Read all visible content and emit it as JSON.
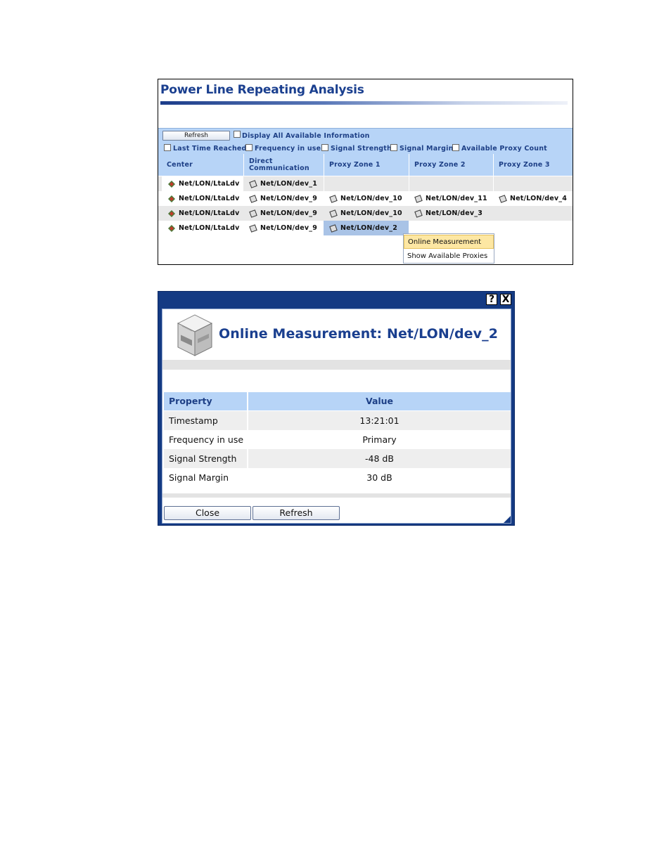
{
  "analysis": {
    "title": "Power Line Repeating Analysis",
    "refresh_label": "Refresh",
    "display_all_label": "Display All Available Information",
    "filters": [
      "Last Time Reached",
      "Frequency in use",
      "Signal Strength",
      "Signal Margin",
      "Available Proxy Count"
    ],
    "columns": [
      "Center",
      "Direct Communication",
      "Proxy Zone 1",
      "Proxy Zone 2",
      "Proxy Zone 3"
    ],
    "rows": [
      [
        "Net/LON/LtaLdv",
        "Net/LON/dev_1",
        "",
        "",
        ""
      ],
      [
        "Net/LON/LtaLdv",
        "Net/LON/dev_9",
        "Net/LON/dev_10",
        "Net/LON/dev_11",
        "Net/LON/dev_4"
      ],
      [
        "Net/LON/LtaLdv",
        "Net/LON/dev_9",
        "Net/LON/dev_10",
        "Net/LON/dev_3",
        ""
      ],
      [
        "Net/LON/LtaLdv",
        "Net/LON/dev_9",
        "Net/LON/dev_2",
        "",
        ""
      ]
    ],
    "context_menu": [
      "Online Measurement",
      "Show Available Proxies"
    ]
  },
  "dialog": {
    "help_icon": "?",
    "close_icon": "X",
    "title": "Online Measurement: Net/LON/dev_2",
    "header_property": "Property",
    "header_value": "Value",
    "properties": [
      {
        "property": "Timestamp",
        "value": "13:21:01"
      },
      {
        "property": "Frequency in use",
        "value": "Primary"
      },
      {
        "property": "Signal Strength",
        "value": "-48 dB"
      },
      {
        "property": "Signal Margin",
        "value": "30 dB"
      }
    ],
    "close_label": "Close",
    "refresh_label": "Refresh"
  },
  "colors": {
    "title_blue": "#1a3f8f",
    "header_bg": "#b7d4f7",
    "dialog_frame": "#143a83",
    "menu_highlight": "#fde7a3"
  }
}
